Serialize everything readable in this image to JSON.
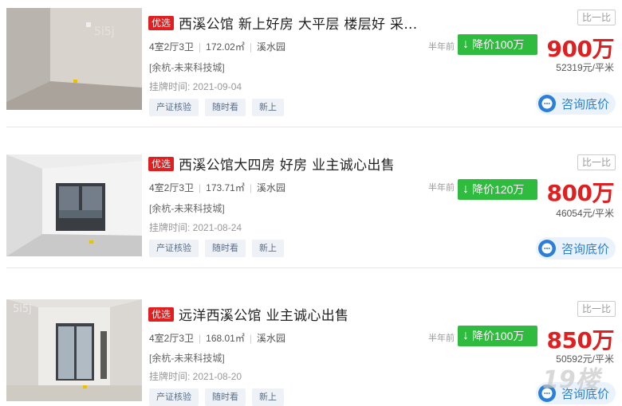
{
  "listings": [
    {
      "badge": "优选",
      "title": "西溪公馆 新上好房 大平层 楼层好 采...",
      "layout": "4室2厅3卫",
      "size": "172.02㎡",
      "community": "溪水园",
      "district": "[余杭-未来科技城]",
      "listed": "挂牌时间:   2021-09-04",
      "tags": [
        "产证核验",
        "随时看",
        "新上"
      ],
      "compare": "比一比",
      "ago": "半年前",
      "drop": "降价100万",
      "price": "900万",
      "unit_price": "52319元/平米",
      "consult": "咨询底价",
      "thumb_watermark": "5i5j"
    },
    {
      "badge": "优选",
      "title": "西溪公馆大四房 好房 业主诚心出售",
      "layout": "4室2厅3卫",
      "size": "173.71㎡",
      "community": "溪水园",
      "district": "[余杭-未来科技城]",
      "listed": "挂牌时间:   2021-08-24",
      "tags": [
        "产证核验",
        "随时看",
        "新上"
      ],
      "compare": "比一比",
      "ago": "半年前",
      "drop": "降价120万",
      "price": "800万",
      "unit_price": "46054元/平米",
      "consult": "咨询底价",
      "thumb_watermark": ""
    },
    {
      "badge": "优选",
      "title": "远洋西溪公馆 业主诚心出售",
      "layout": "4室2厅3卫",
      "size": "168.01㎡",
      "community": "溪水园",
      "district": "[余杭-未来科技城]",
      "listed": "挂牌时间:   2021-08-20",
      "tags": [
        "产证核验",
        "随时看",
        "新上"
      ],
      "compare": "比一比",
      "ago": "半年前",
      "drop": "降价100万",
      "price": "850万",
      "unit_price": "50592元/平米",
      "consult": "咨询底价",
      "thumb_watermark": "5i5j"
    }
  ],
  "site_watermark": "19楼",
  "colors": {
    "accent_red": "#e02020",
    "drop_green": "#2fbb3d",
    "consult_blue": "#2b7fd8"
  }
}
